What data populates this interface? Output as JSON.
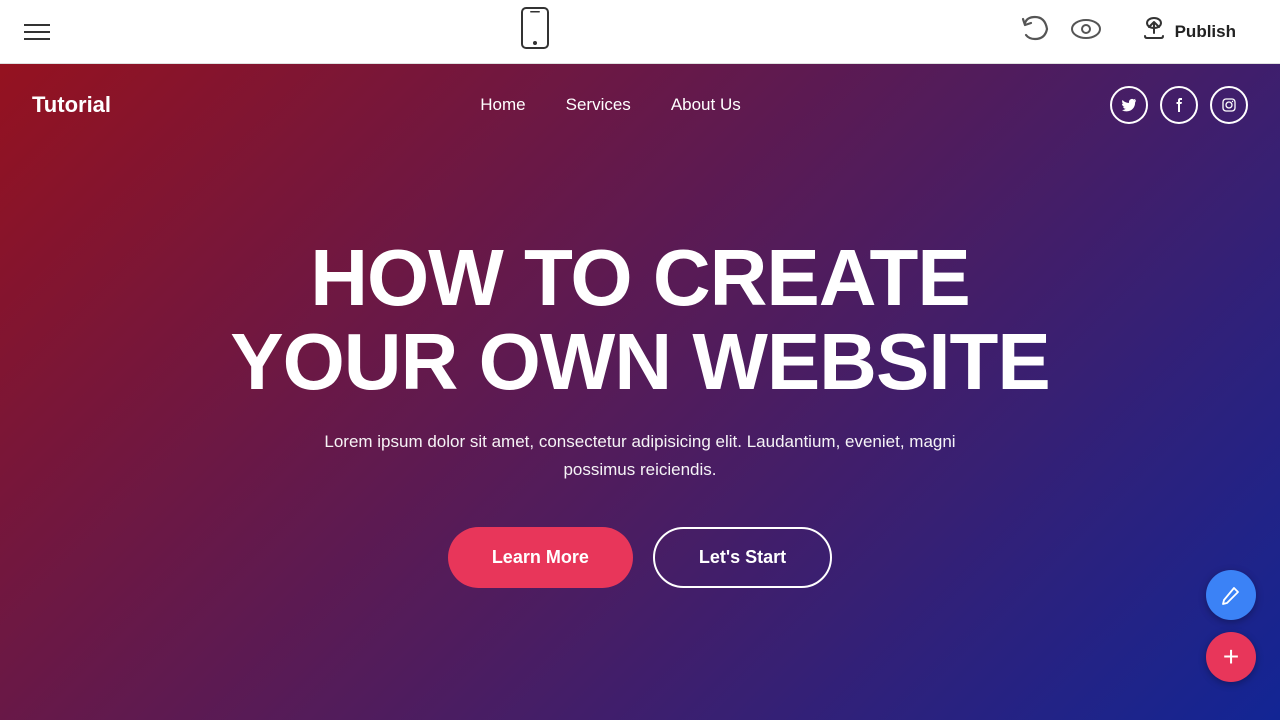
{
  "toolbar": {
    "hamburger_label": "menu",
    "phone_icon": "📱",
    "undo_icon": "↺",
    "eye_icon": "👁",
    "publish_label": "Publish",
    "upload_icon": "⬆"
  },
  "site_nav": {
    "logo": "Tutorial",
    "links": [
      {
        "label": "Home"
      },
      {
        "label": "Services"
      },
      {
        "label": "About Us"
      }
    ],
    "social": [
      {
        "icon": "t",
        "label": "Twitter"
      },
      {
        "icon": "f",
        "label": "Facebook"
      },
      {
        "icon": "in",
        "label": "Instagram"
      }
    ]
  },
  "hero": {
    "title_line1": "HOW TO CREATE",
    "title_line2": "YOUR OWN WEBSITE",
    "subtitle": "Lorem ipsum dolor sit amet, consectetur adipisicing elit. Laudantium, eveniet, magni possimus reiciendis.",
    "btn_learn_more": "Learn More",
    "btn_lets_start": "Let's Start"
  },
  "fab": {
    "edit_icon": "✏",
    "add_icon": "+"
  }
}
